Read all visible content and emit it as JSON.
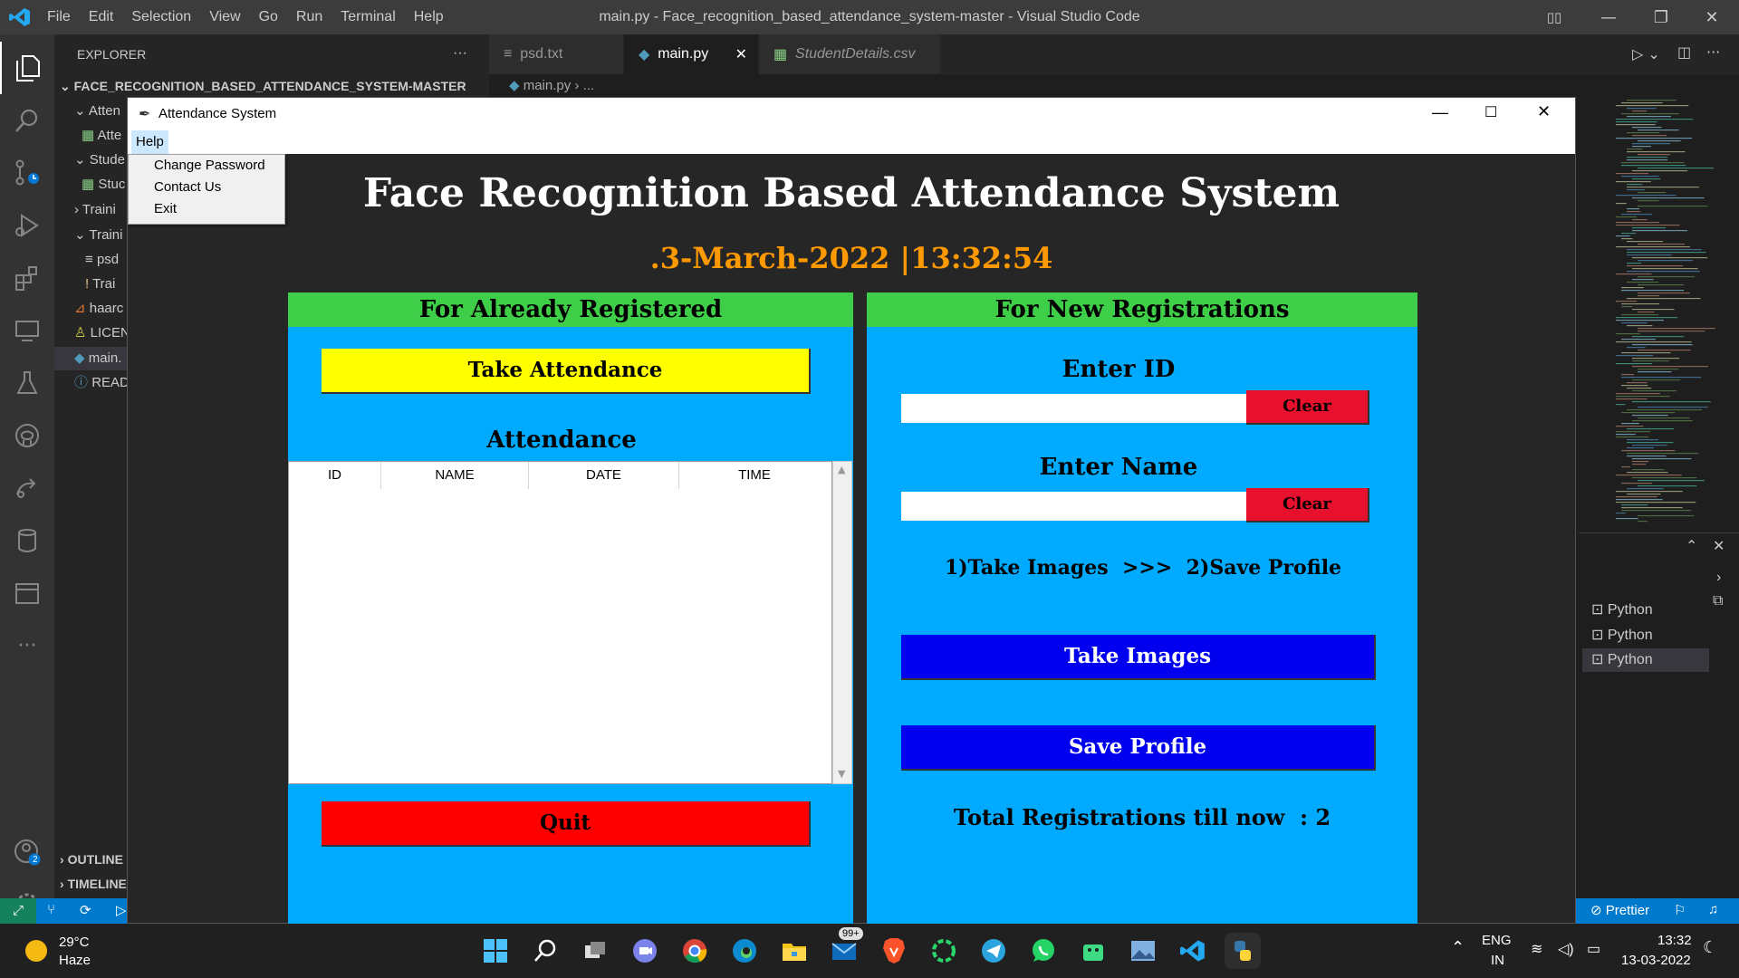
{
  "vscode": {
    "menu": [
      "File",
      "Edit",
      "Selection",
      "View",
      "Go",
      "Run",
      "Terminal",
      "Help"
    ],
    "window_title": "main.py - Face_recognition_based_attendance_system-master - Visual Studio Code",
    "explorer_title": "EXPLORER",
    "explorer_more": "···",
    "project_root": "FACE_RECOGNITION_BASED_ATTENDANCE_SYSTEM-MASTER",
    "tree": [
      {
        "label": "Atten",
        "chevron": "⌄"
      },
      {
        "label": "Atte"
      },
      {
        "label": "Stude",
        "chevron": "⌄"
      },
      {
        "label": "Stuc"
      },
      {
        "label": "Traini",
        "chevron": "›"
      },
      {
        "label": "Traini",
        "chevron": "⌄"
      },
      {
        "label": "psd"
      },
      {
        "label": "Trai"
      },
      {
        "label": "haarc"
      },
      {
        "label": "LICEN"
      },
      {
        "label": "main."
      },
      {
        "label": "READ"
      }
    ],
    "outline": "OUTLINE",
    "timeline": "TIMELINE",
    "tabs": [
      {
        "label": "psd.txt",
        "icon": "≡"
      },
      {
        "label": "main.py",
        "icon": "python-icon",
        "close": "✕"
      },
      {
        "label": "StudentDetails.csv",
        "icon": "csv-icon"
      }
    ],
    "breadcrumb": "main.py  ›  ...",
    "terminals": [
      "Python",
      "Python",
      "Python"
    ],
    "status_prettier": "Prettier",
    "account_badge": "2"
  },
  "tk": {
    "window_title": "Attendance System",
    "menu_help": "Help",
    "help_items": [
      "Change Password",
      "Contact Us",
      "Exit"
    ],
    "heading": "Face Recognition Based Attendance System",
    "date_time": ".3-March-2022  |13:32:54",
    "left": {
      "header": "For Already Registered",
      "take_attendance": "Take Attendance",
      "attendance_label": "Attendance",
      "columns": [
        "ID",
        "NAME",
        "DATE",
        "TIME"
      ],
      "quit": "Quit"
    },
    "right": {
      "header": "For New Registrations",
      "enter_id": "Enter ID",
      "id_value": "",
      "clear1": "Clear",
      "enter_name": "Enter Name",
      "name_value": "",
      "clear2": "Clear",
      "steps": "1)Take Images  >>>  2)Save Profile",
      "take_images": "Take Images",
      "save_profile": "Save Profile",
      "total": "Total Registrations till now  : 2"
    }
  },
  "taskbar": {
    "temp": "29°C",
    "weather": "Haze",
    "mail_badge": "99+",
    "lang1": "ENG",
    "lang2": "IN",
    "time": "13:32",
    "date": "13-03-2022"
  },
  "colors": {
    "frame_blue": "#00aaff",
    "header_green": "#3ece48",
    "yellow": "#ffff00",
    "red": "#ff0000",
    "clear_red": "#e8112d",
    "blue_btn": "#0000ee",
    "orange_text": "#ff9900"
  }
}
